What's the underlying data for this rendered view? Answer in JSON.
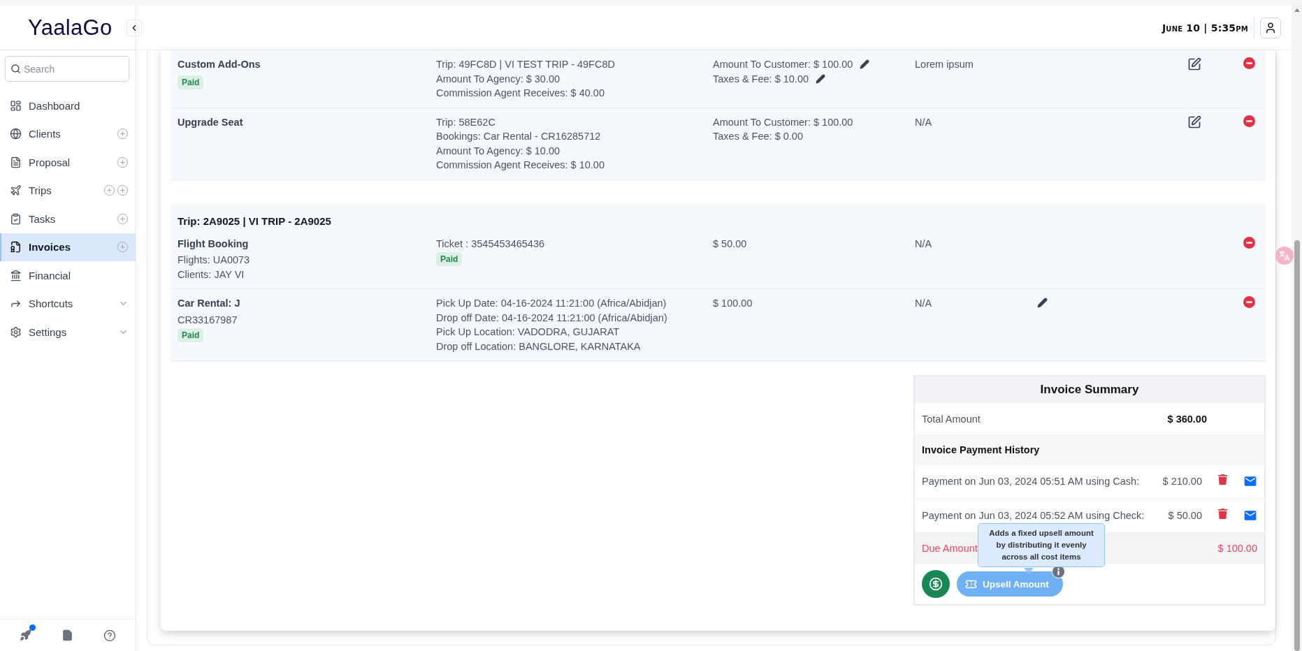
{
  "app": {
    "logo": "YaalaGo"
  },
  "header": {
    "datetime": "June 10 | 5:35pm"
  },
  "sidebar": {
    "search_placeholder": "Search",
    "items": [
      {
        "label": "Dashboard",
        "selected": false,
        "kind": "plain"
      },
      {
        "label": "Clients",
        "selected": false,
        "kind": "add"
      },
      {
        "label": "Proposal",
        "selected": false,
        "kind": "add"
      },
      {
        "label": "Trips",
        "selected": false,
        "kind": "multiadd"
      },
      {
        "label": "Tasks",
        "selected": false,
        "kind": "add"
      },
      {
        "label": "Invoices",
        "selected": true,
        "kind": "add"
      },
      {
        "label": "Financial",
        "selected": false,
        "kind": "plain"
      },
      {
        "label": "Shortcuts",
        "selected": false,
        "kind": "menu",
        "expanded": false
      },
      {
        "label": "Settings",
        "selected": false,
        "kind": "menu",
        "expanded": false
      }
    ],
    "footer": {
      "has_update": true
    }
  },
  "groups": [
    {
      "rows": [
        {
          "name": "Custom Add-Ons",
          "info": [
            {
              "kind": "badge",
              "text": "Paid"
            }
          ],
          "details": [
            {
              "kind": "text",
              "text": "Trip: 49FC8D | VI TEST TRIP - 49FC8D"
            },
            {
              "kind": "text",
              "text": "Amount To Agency: $ 30.00"
            },
            {
              "kind": "text",
              "text": "Commission Agent Receives: $ 40.00"
            }
          ],
          "amounts": [
            {
              "kind": "editable",
              "text": "Amount To Customer: $ 100.00"
            },
            {
              "kind": "editable",
              "text": "Taxes & Fee: $ 10.00"
            }
          ],
          "note": "Lorem ipsum",
          "kind": "boxed",
          "removable": true
        },
        {
          "name": "Upgrade Seat",
          "info": [],
          "details": [
            {
              "kind": "text",
              "text": "Trip: 58E62C"
            },
            {
              "kind": "text",
              "text": "Bookings: Car Rental - CR16285712"
            },
            {
              "kind": "text",
              "text": "Amount To Agency: $ 10.00"
            },
            {
              "kind": "text",
              "text": "Commission Agent Receives: $ 10.00"
            }
          ],
          "amounts": [
            {
              "kind": "text",
              "text": "Amount To Customer: $ 100.00"
            },
            {
              "kind": "text",
              "text": "Taxes & Fee: $ 0.00"
            }
          ],
          "note": "N/A",
          "kind": "boxed",
          "removable": true
        }
      ]
    },
    {
      "title": "Trip: 2A9025 | VI TRIP - 2A9025",
      "rows": [
        {
          "name": "Flight Booking",
          "info": [
            {
              "kind": "text",
              "text": "Flights: UA0073"
            },
            {
              "kind": "text",
              "text": "Clients: JAY VI"
            }
          ],
          "details": [
            {
              "kind": "text",
              "text": "Ticket : 3545453465436"
            },
            {
              "kind": "badge",
              "text": "Paid"
            }
          ],
          "amounts": [
            {
              "kind": "text",
              "text": "$ 50.00"
            }
          ],
          "note": "N/A",
          "kind": "plain",
          "removable": true
        },
        {
          "name": "Car Rental: J",
          "info": [
            {
              "kind": "text",
              "text": "CR33167987"
            },
            {
              "kind": "badge",
              "text": "Paid"
            }
          ],
          "details": [
            {
              "kind": "text",
              "text": "Pick Up Date: 04-16-2024 11:21:00 (Africa/Abidjan)"
            },
            {
              "kind": "text",
              "text": "Drop off Date: 04-16-2024 11:21:00 (Africa/Abidjan)"
            },
            {
              "kind": "text",
              "text": "Pick Up Location: VADODRA, GUJARAT"
            },
            {
              "kind": "text",
              "text": "Drop off Location: BANGLORE, KARNATAKA"
            }
          ],
          "amounts": [
            {
              "kind": "text",
              "text": "$ 100.00"
            }
          ],
          "note": "N/A",
          "kind": "pencil",
          "removable": true
        }
      ]
    }
  ],
  "summary": {
    "title": "Invoice Summary",
    "total": {
      "label": "Total Amount",
      "value": "$ 360.00"
    },
    "history_title": "Invoice Payment History",
    "payments": [
      {
        "text": "Payment on Jun 03, 2024 05:51 AM using Cash:",
        "amount": "$ 210.00"
      },
      {
        "text": "Payment on Jun 03, 2024 05:52 AM using Check:",
        "amount": "$ 50.00"
      }
    ],
    "due": {
      "label": "Due Amount",
      "value": "$ 100.00"
    },
    "tooltip": "Adds a fixed upsell amount by distributing it evenly across all cost items",
    "upsell_button": "Upsell Amount"
  }
}
